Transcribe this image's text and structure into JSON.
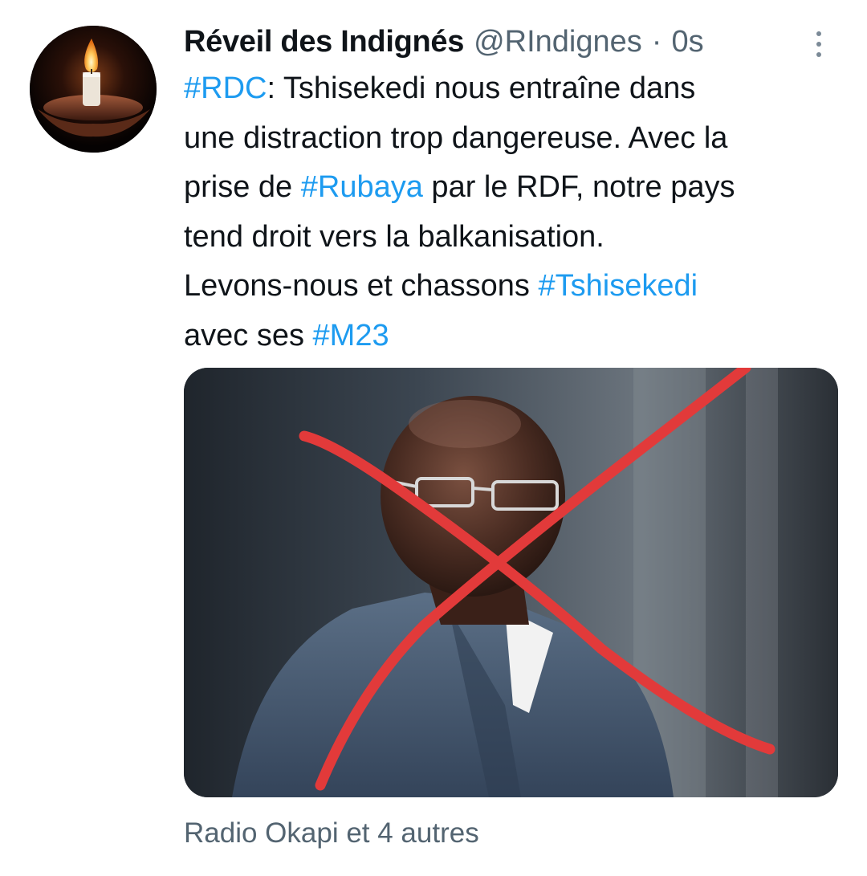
{
  "tweet": {
    "author": {
      "display_name": "Réveil des Indignés",
      "handle": "@RIndignes",
      "separator": "·",
      "timestamp": "0s",
      "avatar_icon": "candle-flame-avatar"
    },
    "more_icon": "more-vertical-icon",
    "text_lines": [
      [
        {
          "t": "#RDC",
          "tag": true
        },
        {
          "t": ": Tshisekedi nous entraîne dans",
          "tag": false
        }
      ],
      [
        {
          "t": "une distraction trop dangereuse. Avec la",
          "tag": false
        }
      ],
      [
        {
          "t": "prise de ",
          "tag": false
        },
        {
          "t": "#Rubaya",
          "tag": true
        },
        {
          "t": " par le RDF, notre pays",
          "tag": false
        }
      ],
      [
        {
          "t": "tend droit vers la balkanisation.",
          "tag": false
        }
      ],
      [
        {
          "t": "Levons-nous et chassons ",
          "tag": false
        },
        {
          "t": "#Tshisekedi",
          "tag": true
        }
      ],
      [
        {
          "t": "avec ses ",
          "tag": false
        },
        {
          "t": "#M23",
          "tag": true
        }
      ]
    ],
    "media": {
      "overlay": "red-x-cross"
    },
    "tagged_people": "Radio Okapi et 4 autres"
  },
  "colors": {
    "text": "#0f1419",
    "muted": "#536471",
    "link": "#1d9bf0",
    "cross": "#e23a3a"
  }
}
